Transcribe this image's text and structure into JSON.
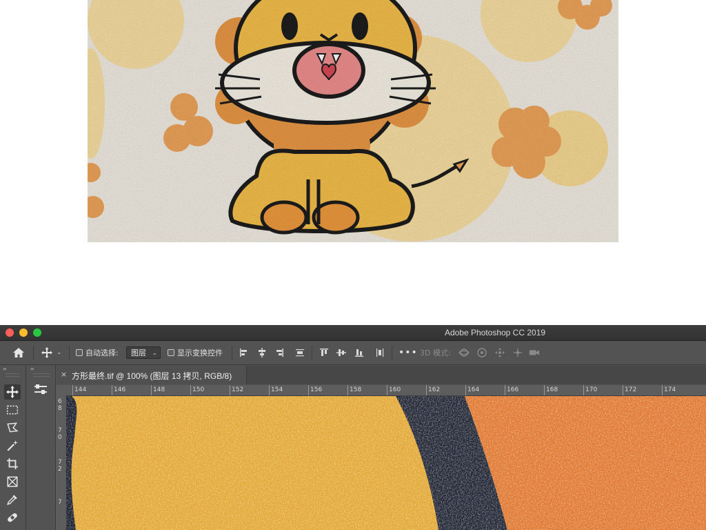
{
  "window": {
    "title": "Adobe Photoshop CC 2019"
  },
  "options_bar": {
    "auto_select_label": "自动选择:",
    "auto_select_value": "图层",
    "show_transform_label": "显示变换控件",
    "mode_3d_label": "3D 模式:"
  },
  "document_tab": {
    "close_glyph": "×",
    "title": "方形最终.tif @ 100% (图层 13 拷贝, RGB/8)"
  },
  "panels": {
    "collapse_glyph": "››"
  },
  "tools": [
    "move-tool",
    "marquee-tool",
    "lasso-tool",
    "magic-wand-tool",
    "crop-tool",
    "frame-tool",
    "eyedropper-tool",
    "healing-brush-tool"
  ],
  "ruler": {
    "horizontal_ticks": [
      "144",
      "146",
      "148",
      "150",
      "152",
      "154",
      "156",
      "158",
      "160",
      "162",
      "164",
      "166",
      "168",
      "170",
      "172",
      "174"
    ],
    "vertical_ticks": [
      "6",
      "8",
      "7",
      "0",
      "7",
      "2",
      "7"
    ]
  },
  "colors": {
    "ps_background": "#535353",
    "canvas_yellow": "#e3a93a",
    "canvas_orange": "#e07a36",
    "stroke_dark": "#1c2233",
    "illustration_bg": "#f1ece3"
  }
}
